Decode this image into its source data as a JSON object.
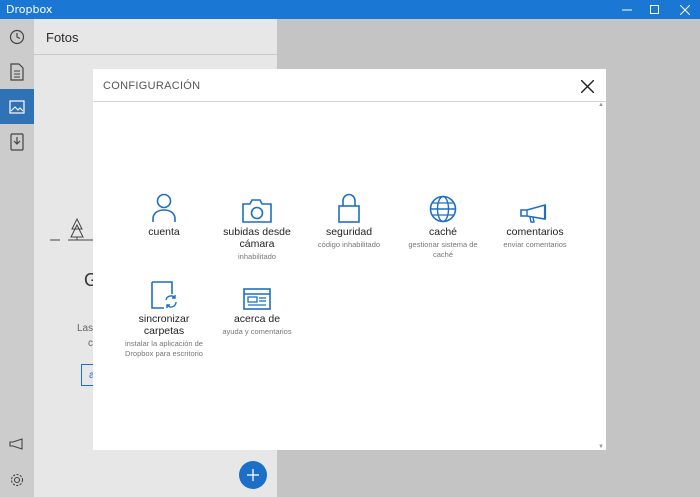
{
  "window": {
    "title": "Dropbox"
  },
  "pane": {
    "title": "Fotos",
    "partial_heading": "G",
    "partial_text_1": "Las",
    "partial_text_2": "ca",
    "partial_button": "a"
  },
  "dialog": {
    "title": "CONFIGURACIÓN",
    "tiles": [
      {
        "icon": "person-icon",
        "label": "cuenta",
        "sub": ""
      },
      {
        "icon": "camera-icon",
        "label": "subidas desde cámara",
        "sub": "inhabilitado"
      },
      {
        "icon": "lock-icon",
        "label": "seguridad",
        "sub": "código inhabilitado"
      },
      {
        "icon": "globe-icon",
        "label": "caché",
        "sub": "gestionar sistema de caché"
      },
      {
        "icon": "megaphone-icon",
        "label": "comentarios",
        "sub": "enviar comentarios"
      },
      {
        "icon": "folder-sync-icon",
        "label": "sincronizar carpetas",
        "sub": "instalar la aplicación de Dropbox para escritorio"
      },
      {
        "icon": "about-card-icon",
        "label": "acerca de",
        "sub": "ayuda y comentarios"
      }
    ]
  },
  "colors": {
    "accent": "#1a78d4",
    "icon_blue": "#1e6fc4",
    "rail_active": "#2f72b5"
  }
}
